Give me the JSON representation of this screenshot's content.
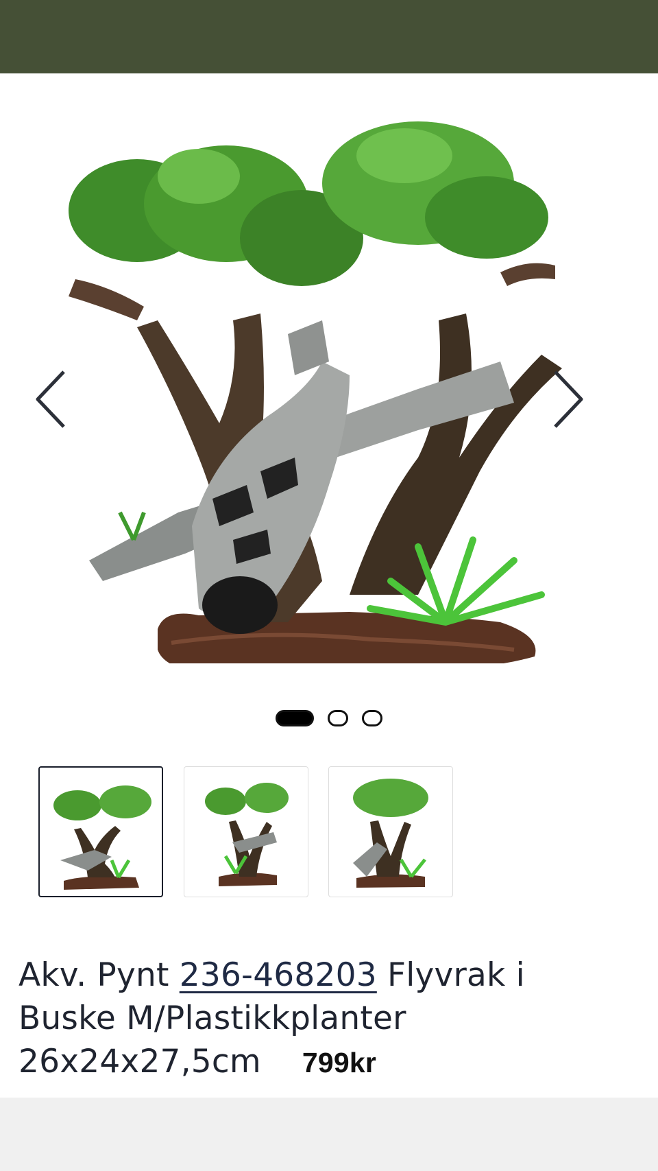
{
  "product": {
    "title_prefix": "Akv. Pynt ",
    "sku": "236-468203",
    "title_line1_rest": " Flyvrak i",
    "title_line2": "Buske M/Plastikkplanter",
    "title_line3": "26x24x27,5cm",
    "price": "799kr"
  },
  "gallery": {
    "main_image_alt": "Akv. Pynt Flyvrak i Buske",
    "prev_icon": "chevron-left-icon",
    "next_icon": "chevron-right-icon",
    "dots": [
      {
        "active": true
      },
      {
        "active": false
      },
      {
        "active": false
      }
    ],
    "thumbnails": [
      {
        "active": true
      },
      {
        "active": false
      },
      {
        "active": false
      }
    ]
  },
  "colors": {
    "topbar": "#455036",
    "text": "#1f2430",
    "sku_link": "#1f2a44",
    "footer": "#f0f0f0"
  }
}
